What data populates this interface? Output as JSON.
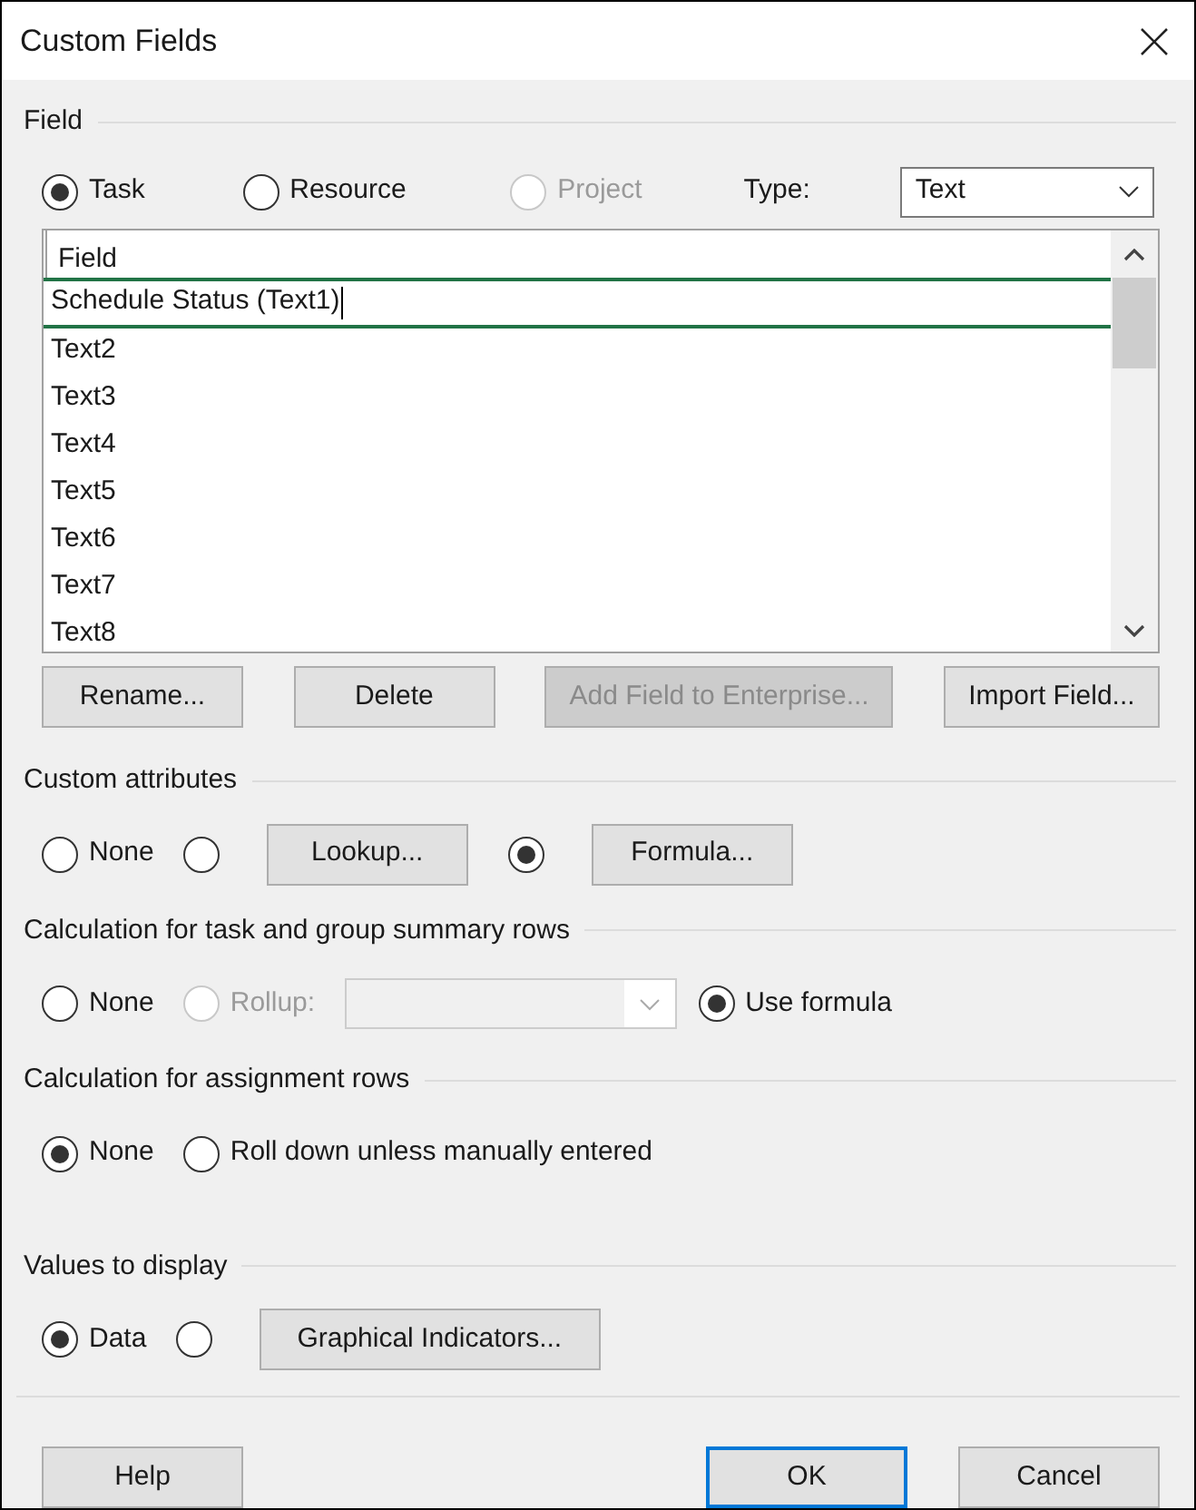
{
  "window": {
    "title": "Custom Fields"
  },
  "field_group": {
    "title": "Field",
    "options": [
      {
        "label": "Task",
        "selected": true,
        "disabled": false
      },
      {
        "label": "Resource",
        "selected": false,
        "disabled": false
      },
      {
        "label": "Project",
        "selected": false,
        "disabled": true
      }
    ],
    "type_label": "Type:",
    "type_value": "Text"
  },
  "field_list": {
    "header": "Field",
    "rows": [
      {
        "label": "Schedule Status (Text1)",
        "selected": true
      },
      {
        "label": "Text2",
        "selected": false
      },
      {
        "label": "Text3",
        "selected": false
      },
      {
        "label": "Text4",
        "selected": false
      },
      {
        "label": "Text5",
        "selected": false
      },
      {
        "label": "Text6",
        "selected": false
      },
      {
        "label": "Text7",
        "selected": false
      },
      {
        "label": "Text8",
        "selected": false
      }
    ]
  },
  "field_buttons": [
    {
      "label": "Rename...",
      "disabled": false
    },
    {
      "label": "Delete",
      "disabled": false
    },
    {
      "label": "Add Field to Enterprise...",
      "disabled": true
    },
    {
      "label": "Import Field...",
      "disabled": false
    }
  ],
  "sections": [
    {
      "title": "Custom attributes",
      "items": [
        {
          "kind": "radio",
          "label": "None",
          "selected": false,
          "disabled": false
        },
        {
          "kind": "radio",
          "selected": false,
          "disabled": false
        },
        {
          "kind": "button",
          "label": "Lookup...",
          "disabled": false
        },
        {
          "kind": "radio",
          "selected": true,
          "disabled": false
        },
        {
          "kind": "button",
          "label": "Formula...",
          "disabled": false
        }
      ]
    },
    {
      "title": "Calculation for task and group summary rows",
      "items": [
        {
          "kind": "radio",
          "label": "None",
          "selected": false,
          "disabled": false
        },
        {
          "kind": "radio",
          "label": "Rollup:",
          "selected": false,
          "disabled": true
        },
        {
          "kind": "dropdown",
          "disabled": true
        },
        {
          "kind": "radio",
          "label": "Use formula",
          "selected": true,
          "disabled": false
        }
      ]
    },
    {
      "title": "Calculation for assignment rows",
      "items": [
        {
          "kind": "radio",
          "label": "None",
          "selected": true,
          "disabled": false
        },
        {
          "kind": "radio",
          "label": "Roll down unless manually entered",
          "selected": false,
          "disabled": false
        }
      ]
    },
    {
      "title": "Values to display",
      "items": [
        {
          "kind": "radio",
          "label": "Data",
          "selected": true,
          "disabled": false
        },
        {
          "kind": "radio",
          "selected": false,
          "disabled": false
        },
        {
          "kind": "button",
          "label": "Graphical Indicators...",
          "disabled": false
        }
      ]
    }
  ],
  "footer_buttons": [
    {
      "label": "Help",
      "default": false
    },
    {
      "label": "OK",
      "default": true
    },
    {
      "label": "Cancel",
      "default": false
    }
  ]
}
